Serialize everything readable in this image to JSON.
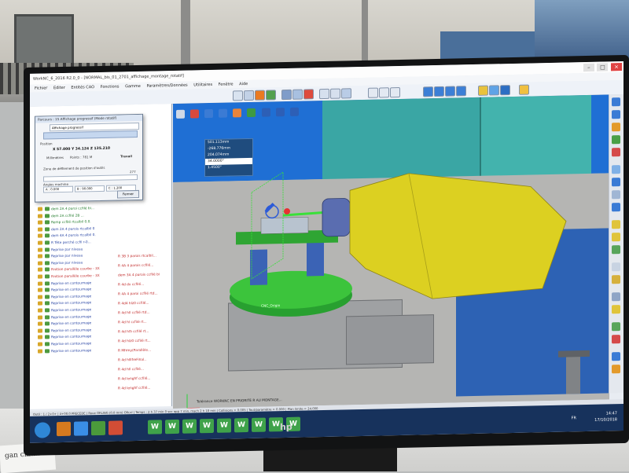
{
  "scene": {
    "monitor_brand": "hp",
    "paper_note": "gan ckhnil"
  },
  "app": {
    "title": "WorkNC_6_2016 R2.0_0 - [NORMAL_bis_01_2701_affichage_montage_rotatif]",
    "window_controls": [
      "–",
      "□",
      "×"
    ],
    "menus": [
      "Fichier",
      "Editer",
      "Entités CAO",
      "Fonctions",
      "Gamme",
      "Paramètres/Données",
      "Utilitaires",
      "Fenêtre",
      "Aide"
    ]
  },
  "dialog": {
    "title": "Parcours : 15 Affichage progressif (Mode rotatif)",
    "subtitle": "Affichage progressif",
    "position_label": "Position",
    "position_value": "X 57.000 Y 34.124 Z 135.210",
    "millimetre_label": "Millimètres",
    "points_label": "Points : 781 M",
    "travail_label": "Travail",
    "slider_label": "Zone de défilement de position d'outils",
    "slider_value": "277",
    "angles_label": "Angles machine",
    "angle_a": "A : 0.000",
    "angle_b": "B : 90.000",
    "angle_c": "C : 1.200",
    "close_button": "Fermer"
  },
  "tree": {
    "rows": [
      {
        "text": "dem 2A 4 paroi ccfilé bi...",
        "color": "green"
      },
      {
        "text": "dem 2A ccfilé 2B ...",
        "color": "green"
      },
      {
        "text": "Remp ccfilé rtcalbil 0.0.",
        "color": "green"
      },
      {
        "text": "dem 2A 4 parois rtcalbil 0",
        "color": "blue"
      },
      {
        "text": "dem 4A 4 parois rtcalbil 0.",
        "color": "blue"
      },
      {
        "text": "R Tête perché ccfil r-0...",
        "color": "blue"
      },
      {
        "text": "Reprise par niveau",
        "color": "blue"
      },
      {
        "text": "Reprise par niveau",
        "color": "blue"
      },
      {
        "text": "Reprise par niveau",
        "color": "blue"
      },
      {
        "text": "Finition parallèle courbe - 3X",
        "color": "red"
      },
      {
        "text": "Finition parallèle courbe - 3X",
        "color": "red"
      },
      {
        "text": "Reprise en contournage",
        "color": "blue"
      },
      {
        "text": "Reprise en contournage",
        "color": "blue"
      },
      {
        "text": "Reprise en contournage",
        "color": "blue"
      },
      {
        "text": "Reprise en contournage",
        "color": "blue"
      },
      {
        "text": "Reprise en contournage",
        "color": "blue"
      },
      {
        "text": "Reprise en contournage",
        "color": "blue"
      },
      {
        "text": "Reprise en contournage",
        "color": "blue"
      },
      {
        "text": "Reprise en contournage",
        "color": "blue"
      },
      {
        "text": "Reprise en contournage",
        "color": "blue"
      },
      {
        "text": "Reprise en contournage",
        "color": "blue"
      },
      {
        "text": "Reprise en contournage",
        "color": "blue"
      }
    ],
    "right_rows": [
      {
        "text": "R 3B 3 parois rtcalbil...",
        "color": "red"
      },
      {
        "text": "R 4A 4 parois ccfilé...",
        "color": "red"
      },
      {
        "text": "dem 3A 4 parois ccfilé bi",
        "color": "red"
      },
      {
        "text": "R 4d dx ccfilé...",
        "color": "red"
      },
      {
        "text": "R 4A 4 paroi ccfilé rtd...",
        "color": "red"
      },
      {
        "text": "R 4d4 hlz0 ccfilé...",
        "color": "red"
      },
      {
        "text": "R 4d hll ccfilé rtd...",
        "color": "red"
      },
      {
        "text": "R 4d hl ccfilé rt...",
        "color": "red"
      },
      {
        "text": "R 4d hl5 ccfilé rt...",
        "color": "red"
      },
      {
        "text": "R 4d hlz0 ccfilé rt...",
        "color": "red"
      },
      {
        "text": "R Mfrmy(Parallèle...",
        "color": "red"
      },
      {
        "text": "R 4d hlllfreFinal..",
        "color": "red"
      },
      {
        "text": "R 4d hll ccfilé...",
        "color": "red"
      },
      {
        "text": "R 4d lenghf ccfilé...",
        "color": "red"
      },
      {
        "text": "R 4d lenghf ccfilé...",
        "color": "red"
      }
    ]
  },
  "coords": {
    "x": "501.113mm",
    "y": "-268.776mm",
    "z": "204.074mm",
    "b": "34.0000°",
    "c": "1.4500°"
  },
  "viewport": {
    "origin_label": "CNC_Origin",
    "bottom_label": "Tolérance WORKNC EN PRIORITÉ R AU MONTAGE..."
  },
  "statusbar": "Outil : 1 / 2+0+ | 4+00.0 PRECEDE | Roue ORLING (0.0 mm) Oficxl | Temps : 2 h 37 min 0 sec   app 7 min, mach 2 h 18 min | Collisions = 0.005 | Tout/paramètre = 0.000 | Plan limite = 24.000",
  "taskbar": {
    "language": "FR",
    "time": "14:47",
    "date": "17/10/2018",
    "app_letter": "W"
  },
  "colors": {
    "viewport_blue": "#1f6fd4",
    "spindle_yellow": "#dcd021",
    "table_green": "#39c03a",
    "taskbar": "#17325c"
  }
}
